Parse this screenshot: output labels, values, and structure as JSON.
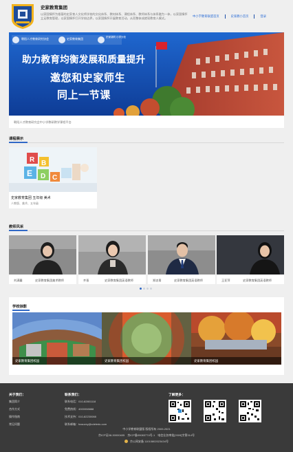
{
  "header": {
    "brand": "史家教育集团",
    "intro": "以家国情怀为根基的史家育人文化将学校的文化体系、教材体系、课程体系、教师体系与体系融为一体，以家国情怀立足教育管理，以家国情怀打开学校边界，以家国情怀开展教育活动，从而整体成就现教育人模式。",
    "links": [
      "中小学教育联盟首页",
      "史家教小首页",
      "登录"
    ]
  },
  "banner": {
    "school_left": "朝阳人才教育研究协会",
    "school_mid": "史家教育集团",
    "school_right": "史家胡同 小学分校",
    "headline": "助力教育均衡发展和质量提升",
    "line2": "邀您和史家师生",
    "line3": "同上一节课",
    "caption": "朝阳人才教育研究会中小学教研教学课程平台"
  },
  "course_section": {
    "title": "课程展示",
    "card": {
      "title": "史家教育集团 五年级 美术",
      "subtitle": "人教版、美术、五年级"
    }
  },
  "teacher_section": {
    "title": "教师风采",
    "teachers": [
      {
        "name": "刘满囊",
        "org": "史家教育集团美术教师"
      },
      {
        "name": "齐晋",
        "org": "史家教育集团英语教师"
      },
      {
        "name": "郑忠青",
        "org": "史家教育集团英语教师"
      },
      {
        "name": "王亚萍",
        "org": "史家教育集团英语教师"
      }
    ]
  },
  "campus_section": {
    "title": "学校掠影",
    "photos": [
      "史家教育集团校园",
      "史家教育集团校园",
      "史家教育集团校园"
    ]
  },
  "footer": {
    "about": {
      "title": "关于我们：",
      "items": [
        "集团简介",
        "合作方式",
        "操作指南",
        "常见问题"
      ]
    },
    "contact": {
      "title": "联系我们：",
      "items": [
        "联系电话：010-82801118",
        "免费热线：4000008888",
        "技术支持：010-82230088",
        "联系邮箱：fuwuzxy@cdeledu.com"
      ]
    },
    "follow": {
      "title": "了解更多："
    },
    "copyright": "中小学教育联盟版 版权所有 2009-2021",
    "icp": "京ICP证08-30000405　京ICP备09083774号-1　电信业务审批[2009]字第314号",
    "police": "京公网安备 11010802023434号"
  },
  "colors": {
    "accent": "#2f68c6",
    "banner_blue": "#1b5bbf",
    "footer_bg": "#3a3a3a"
  }
}
